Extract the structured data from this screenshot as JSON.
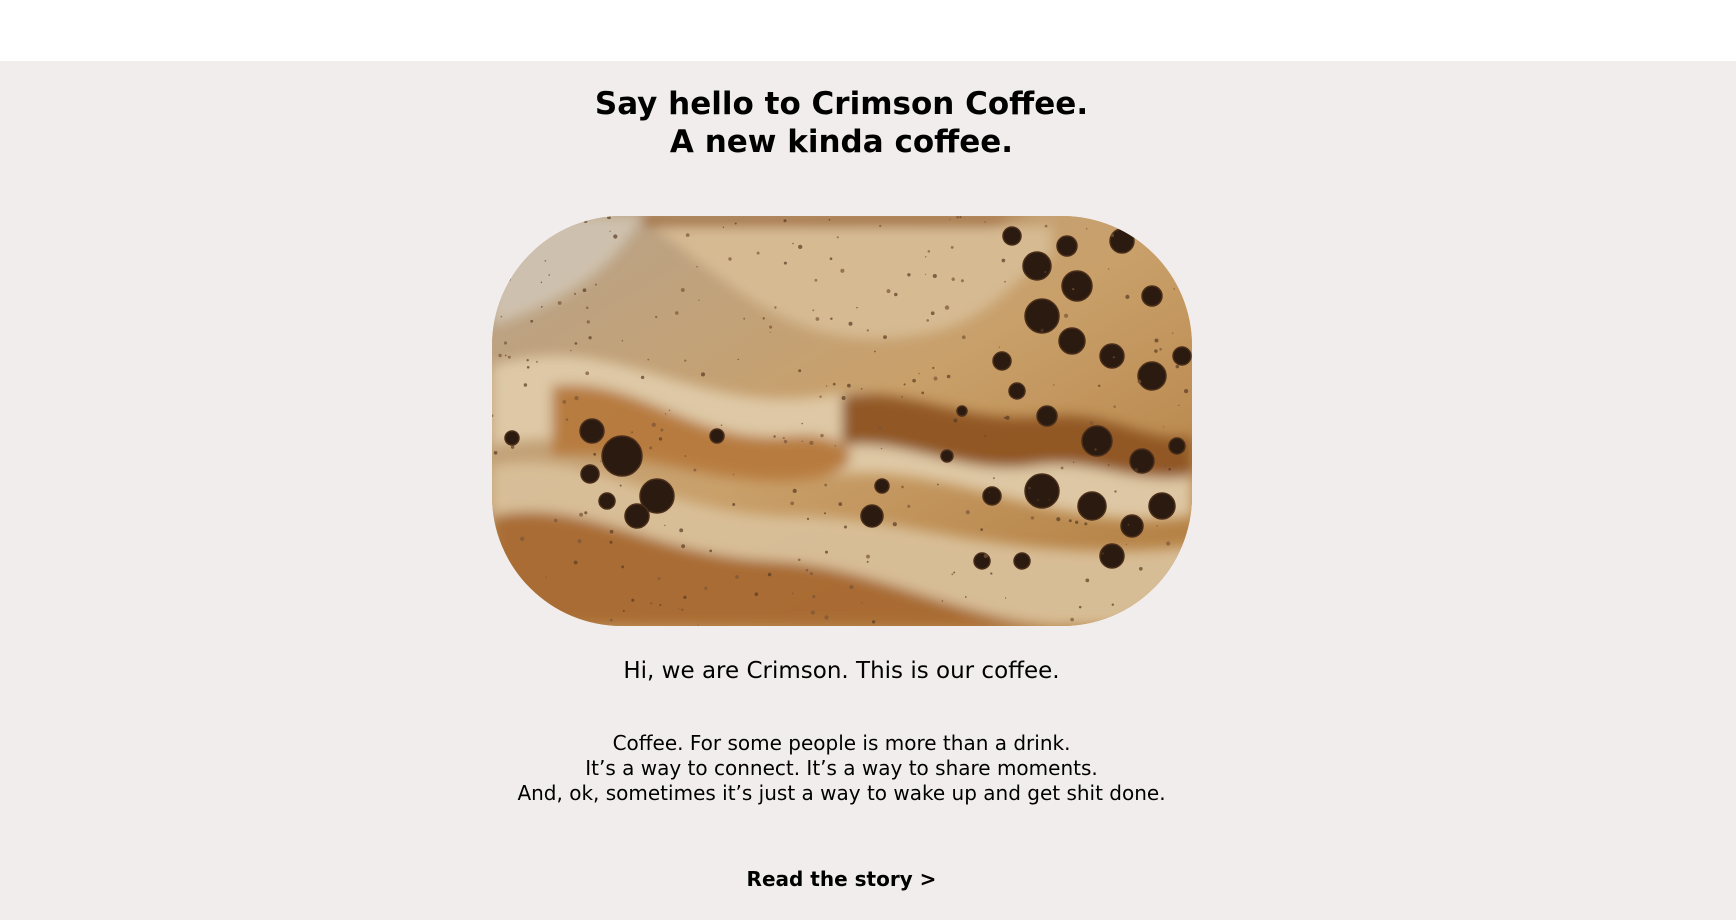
{
  "hero": {
    "headline_line1": "Say hello to Crimson Coffee.",
    "headline_line2": "A new kinda coffee.",
    "image_subject": "coffee-foam-crema-closeup",
    "intro": "Hi, we are Crimson. This is our coffee.",
    "body_lines": [
      "Coffee. For some people is more than a drink.",
      "It’s a way to connect. It’s a way to share moments.",
      "And, ok, sometimes it’s just a way to wake up and get shit done."
    ],
    "cta_label": "Read the story >"
  },
  "colors": {
    "page_background": "#ffffff",
    "hero_background": "#f1eded",
    "text": "#000000",
    "coffee_light": "#e2d2b6",
    "coffee_mid": "#c98f4d",
    "coffee_dark": "#8b5524",
    "bubble": "#2a1a10"
  }
}
